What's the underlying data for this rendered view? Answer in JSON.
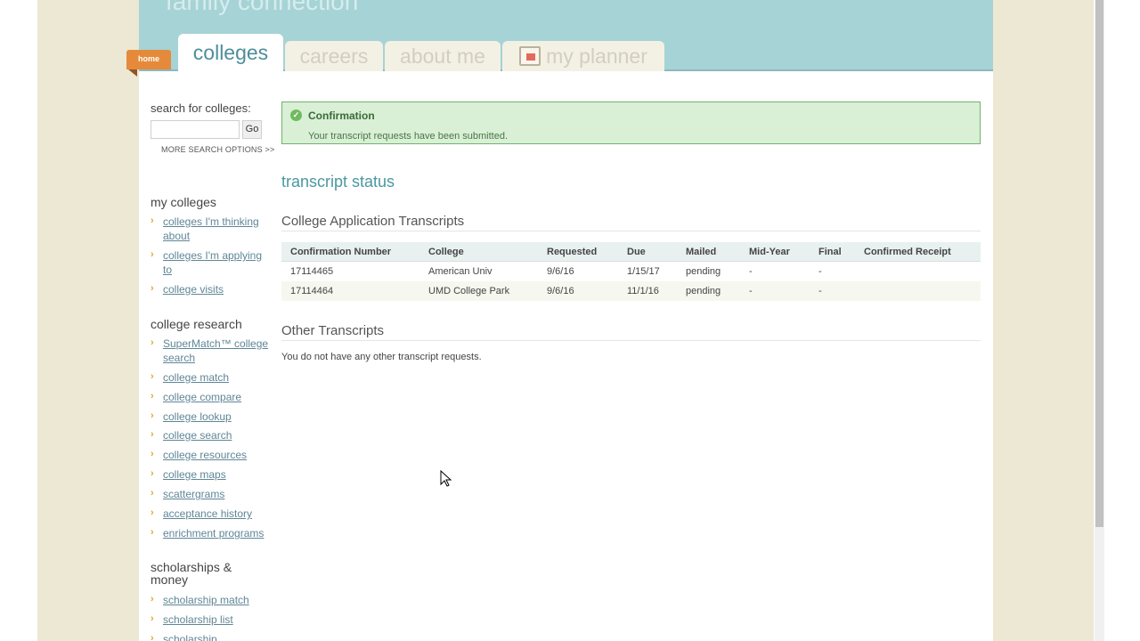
{
  "header": {
    "brand": "family connection",
    "home_label": "home",
    "tabs": [
      {
        "label": "colleges"
      },
      {
        "label": "careers"
      },
      {
        "label": "about me"
      },
      {
        "label": "my planner"
      }
    ]
  },
  "sidebar": {
    "search_label": "search for colleges:",
    "search_value": "",
    "go_label": "Go",
    "more_search": "MORE SEARCH OPTIONS >>",
    "sections": [
      {
        "heading": "my colleges",
        "links": [
          "colleges I'm thinking about",
          "colleges I'm applying to",
          "college visits"
        ]
      },
      {
        "heading": "college research",
        "links": [
          "SuperMatch™ college search",
          "college match",
          "college compare",
          "college lookup",
          "college search",
          "college resources",
          "college maps",
          "scattergrams",
          "acceptance history",
          "enrichment programs"
        ]
      },
      {
        "heading": "scholarships & money",
        "links": [
          "scholarship match",
          "scholarship list",
          "scholarship"
        ]
      }
    ]
  },
  "main": {
    "confirmation": {
      "title": "Confirmation",
      "message": "Your transcript requests have been submitted."
    },
    "page_title": "transcript status",
    "college_section": {
      "heading": "College Application Transcripts",
      "columns": [
        "Confirmation Number",
        "College",
        "Requested",
        "Due",
        "Mailed",
        "Mid-Year",
        "Final",
        "Confirmed Receipt"
      ],
      "rows": [
        [
          "17114465",
          "American Univ",
          "9/6/16",
          "1/15/17",
          "pending",
          "-",
          "-",
          ""
        ],
        [
          "17114464",
          "UMD College Park",
          "9/6/16",
          "11/1/16",
          "pending",
          "-",
          "-",
          ""
        ]
      ]
    },
    "other_section": {
      "heading": "Other Transcripts",
      "message": "You do not have any other transcript requests."
    }
  },
  "colors": {
    "header_bg": "#a6d3d6",
    "accent": "#4a98a0",
    "home_tab": "#e58a3a",
    "link": "#5f8696",
    "confirm_bg": "#d9efd6"
  }
}
